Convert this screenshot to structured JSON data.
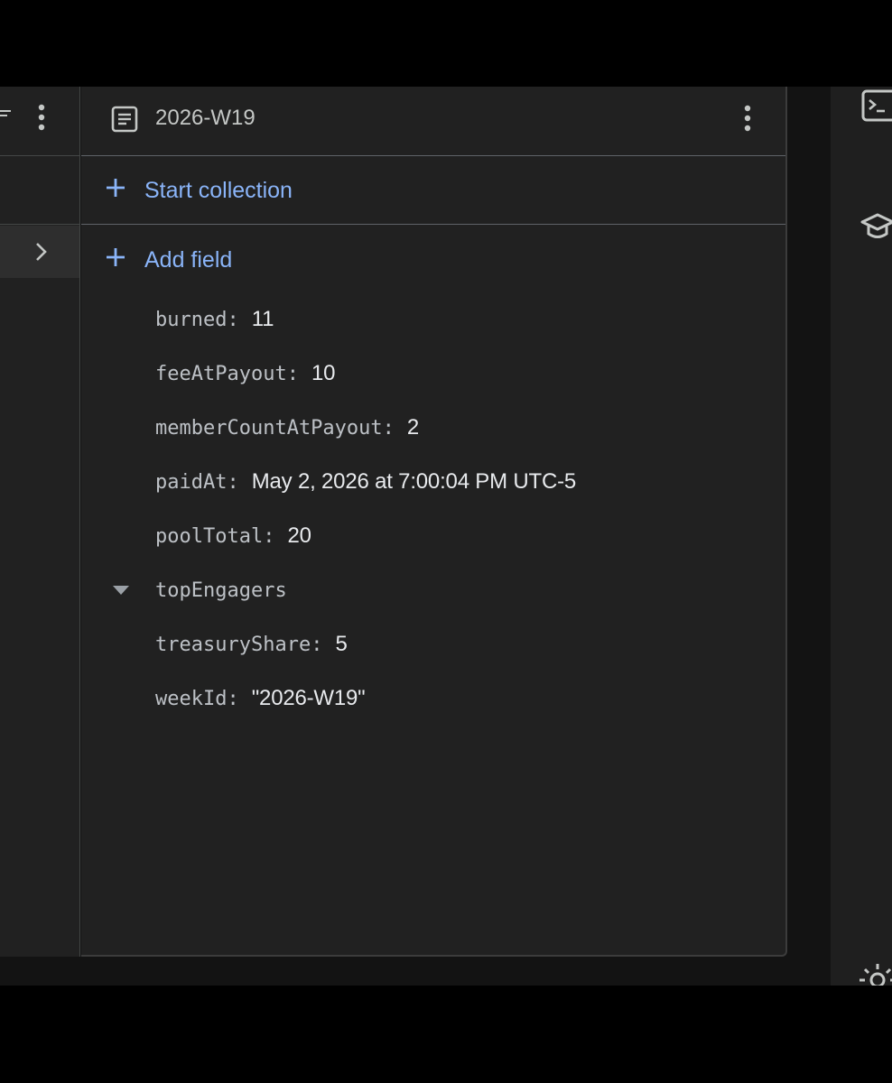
{
  "document": {
    "title": "2026-W19",
    "icon": "document-icon"
  },
  "actions": {
    "start_collection": "Start collection",
    "add_field": "Add field"
  },
  "fields": [
    {
      "key": "burned",
      "value": "11"
    },
    {
      "key": "feeAtPayout",
      "value": "10"
    },
    {
      "key": "memberCountAtPayout",
      "value": "2"
    },
    {
      "key": "paidAt",
      "value": "May 2, 2026 at 7:00:04 PM UTC-5"
    },
    {
      "key": "poolTotal",
      "value": "20"
    },
    {
      "key": "topEngagers",
      "value": "",
      "expandable": true,
      "expanded": true
    },
    {
      "key": "treasuryShare",
      "value": "5"
    },
    {
      "key": "weekId",
      "value": "\"2026-W19\""
    }
  ],
  "icons": {
    "left_panel": [
      "filter-icon",
      "more-vert-icon",
      "chevron-right-icon"
    ],
    "right_rail": [
      "terminal-icon",
      "school-icon",
      "brightness-icon"
    ]
  },
  "colors": {
    "accent": "#8ab4f8",
    "panel": "#212121",
    "background": "#131313"
  }
}
